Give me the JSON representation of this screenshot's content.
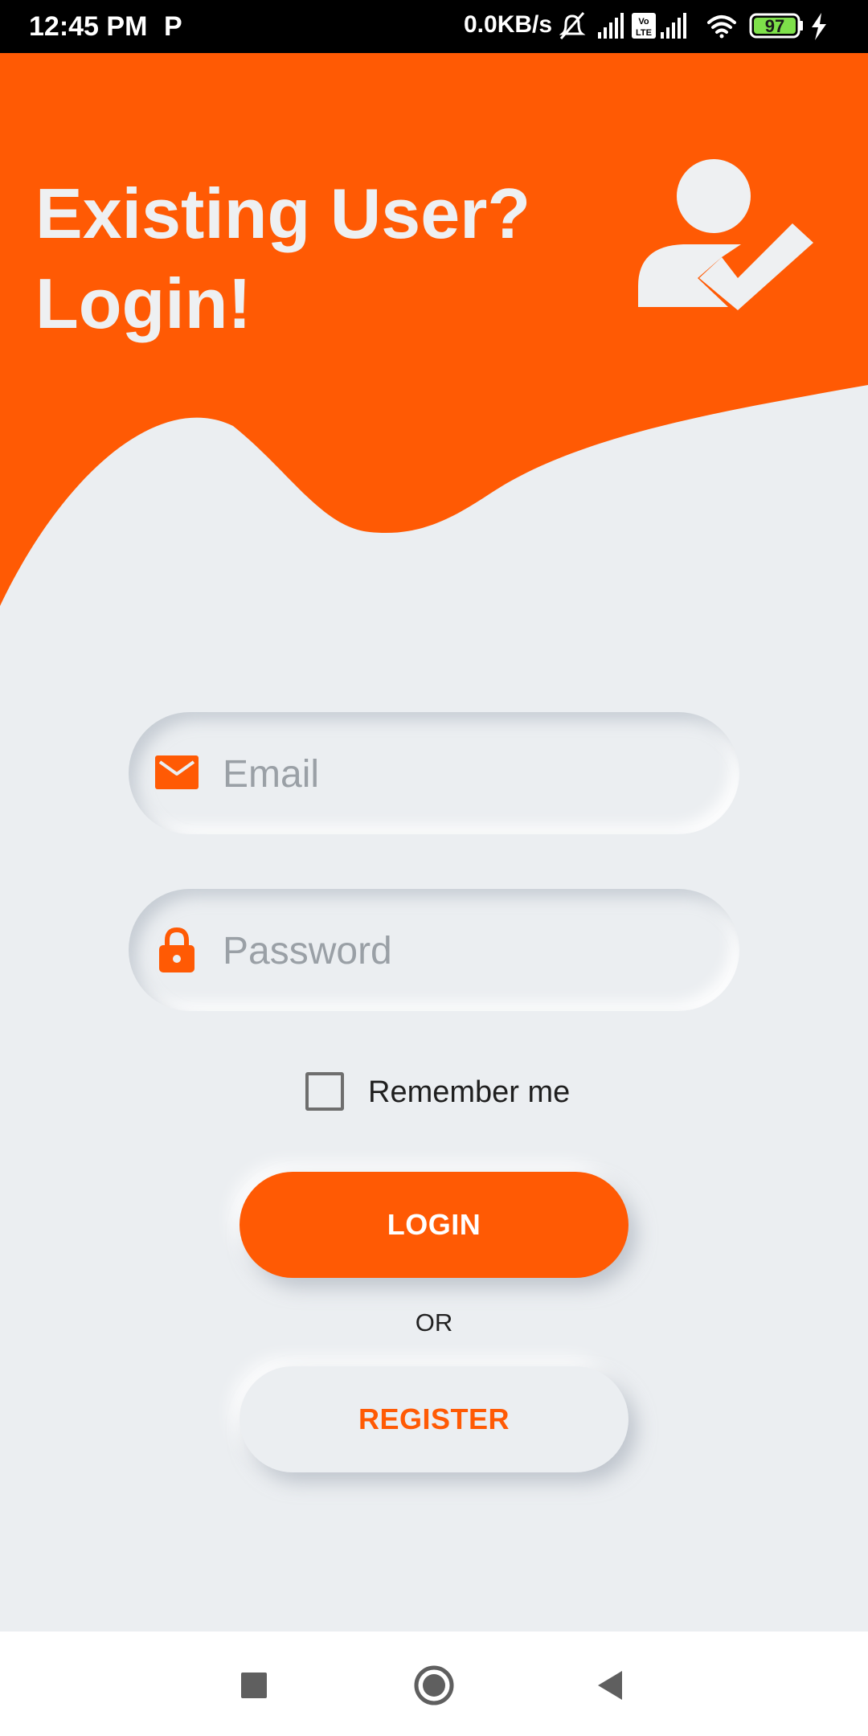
{
  "status_bar": {
    "time": "12:45 PM",
    "notification_icon": "P",
    "net_speed": "0.0KB/s",
    "battery_level": "97",
    "icons": [
      "mute-icon",
      "signal-icon",
      "volte-icon",
      "signal-icon",
      "wifi-icon",
      "battery-icon",
      "charging-icon"
    ]
  },
  "header": {
    "title_line1": "Existing User?",
    "title_line2": "Login!",
    "icon": "user-check-icon"
  },
  "form": {
    "email": {
      "placeholder": "Email",
      "icon": "mail-icon"
    },
    "password": {
      "placeholder": "Password",
      "icon": "lock-icon"
    },
    "remember_label": "Remember me",
    "remember_checked": false,
    "login_label": "LOGIN",
    "or_label": "OR",
    "register_label": "REGISTER"
  },
  "nav_bar": {
    "buttons": [
      "recents-icon",
      "home-icon",
      "back-icon"
    ]
  },
  "colors": {
    "accent": "#ff5a04",
    "background": "#ebeef1",
    "header_text": "#eef0f2",
    "placeholder": "#9aa0a6"
  }
}
